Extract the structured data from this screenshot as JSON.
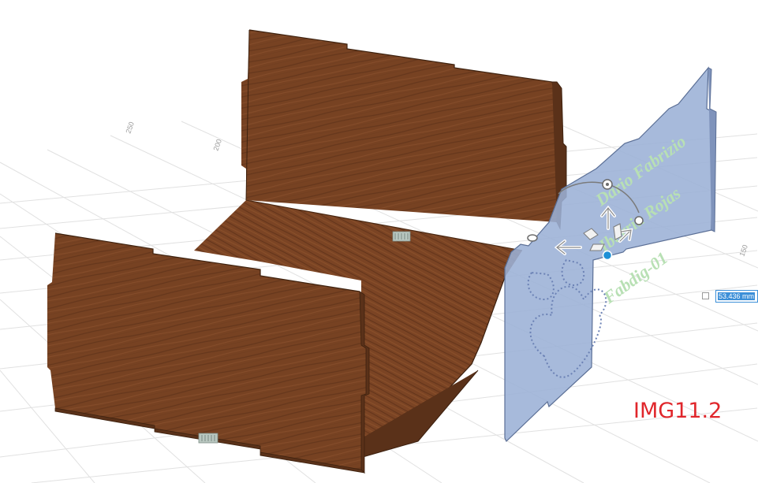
{
  "viewport": {
    "grid_labels": [
      "250",
      "200",
      "150"
    ],
    "engraving": {
      "lines": [
        "Dario Fabrizio",
        "Ibarria Rojas",
        "Fabdig-01"
      ]
    },
    "dimension_input": {
      "value": "53.436 mm"
    },
    "figure_label": "IMG11.2"
  },
  "colors": {
    "wood_dark": "#6b3a1f",
    "wood_mid": "#7d4626",
    "panel_selected": "#9bb0d6",
    "engraving": "#b8e0b4",
    "dimension_accent": "#3c8fd8",
    "figure_label": "#e0262b"
  },
  "icons": [
    "move-arrow-icon",
    "rotate-handle-icon",
    "origin-point-icon"
  ]
}
